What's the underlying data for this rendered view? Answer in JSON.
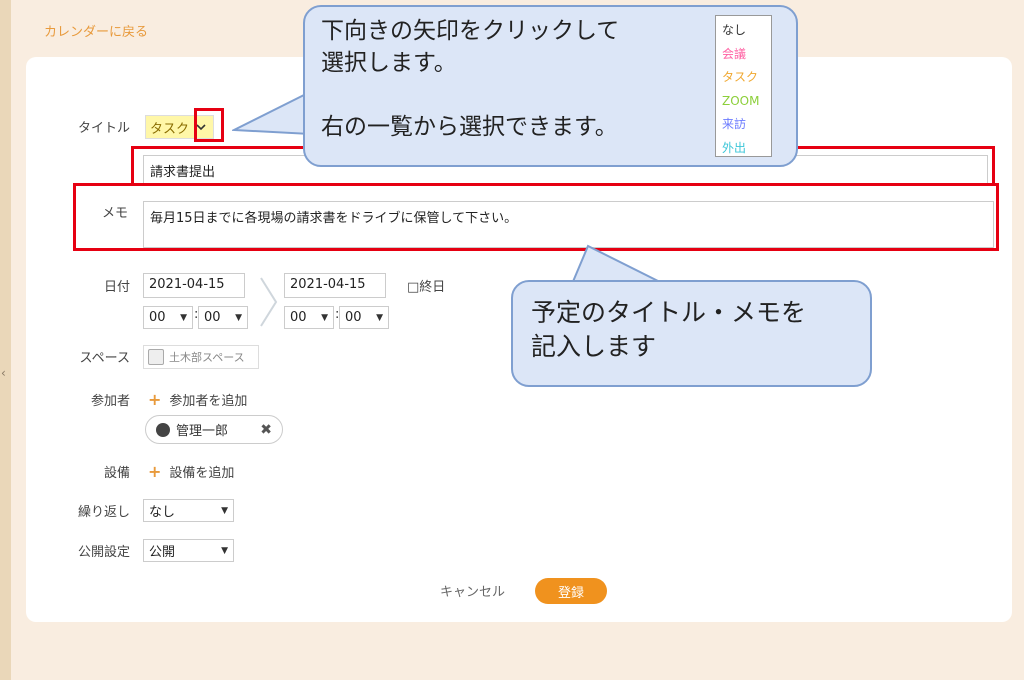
{
  "nav": {
    "back": "カレンダーに戻る"
  },
  "form": {
    "title_label": "タイトル",
    "type_value": "タスク",
    "title_value": "請求書提出",
    "memo_label": "メモ",
    "memo_value": "毎月15日までに各現場の請求書をドライブに保管して下さい。",
    "date_label": "日付",
    "start_date": "2021-04-15",
    "end_date": "2021-04-15",
    "start_hour": "00",
    "start_min": "00",
    "end_hour": "00",
    "end_min": "00",
    "time_sep": ":",
    "allday_label": "□終日",
    "space_label": "スペース",
    "space_value": "土木部スペース",
    "attendees_label": "参加者",
    "add_attendee": "参加者を追加",
    "attendee_name": "管理一郎",
    "equipment_label": "設備",
    "add_equipment": "設備を追加",
    "repeat_label": "繰り返し",
    "repeat_value": "なし",
    "visibility_label": "公開設定",
    "visibility_value": "公開",
    "cancel": "キャンセル",
    "save": "登録"
  },
  "dropdown_options": [
    {
      "label": "なし",
      "color": "#333333"
    },
    {
      "label": "会議",
      "color": "#ff5fa2"
    },
    {
      "label": "タスク",
      "color": "#f0a830"
    },
    {
      "label": "ZOOM",
      "color": "#8ccf3a"
    },
    {
      "label": "来訪",
      "color": "#6b7bff"
    },
    {
      "label": "外出",
      "color": "#3cc6d8"
    }
  ],
  "callouts": {
    "top_line1": "下向きの矢印をクリックして",
    "top_line2": "選択します。",
    "top_line3": "右の一覧から選択できます。",
    "bottom_line1": "予定のタイトル・メモを",
    "bottom_line2": "記入します"
  },
  "colors": {
    "accent": "#f0921e",
    "highlight": "#e60012",
    "callout_bg": "#dce6f7"
  }
}
